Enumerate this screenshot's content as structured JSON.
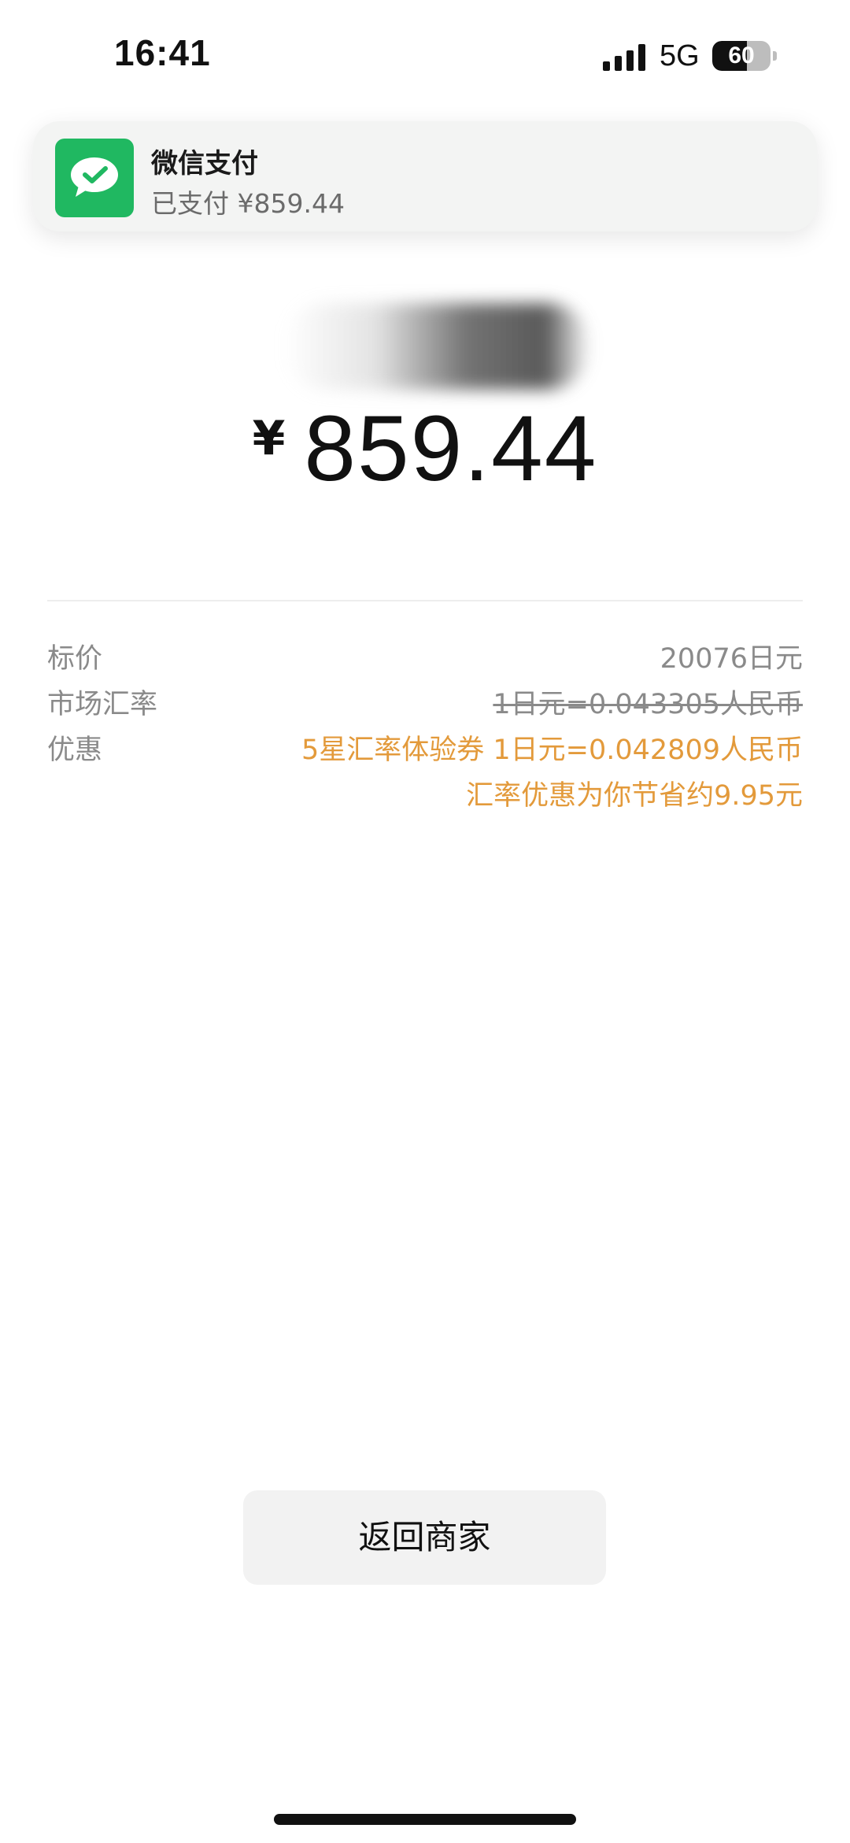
{
  "status_bar": {
    "time": "16:41",
    "network": "5G",
    "battery_level": "60",
    "battery_fraction": 0.6,
    "signal_icon": "signal-bars-icon"
  },
  "notification": {
    "app_icon": "wechat-pay-icon",
    "title": "微信支付",
    "body": "已支付 ¥859.44"
  },
  "payment": {
    "currency_symbol": "¥",
    "amount": "859.44"
  },
  "details": [
    {
      "label": "标价",
      "value": "20076日元",
      "style": "normal"
    },
    {
      "label": "市场汇率",
      "value": "1日元=0.043305人民币",
      "style": "strike"
    },
    {
      "label": "优惠",
      "value": "5星汇率体验券 1日元=0.042809人民币",
      "style": "accent"
    },
    {
      "label": "",
      "value": "汇率优惠为你节省约9.95元",
      "style": "accent"
    }
  ],
  "actions": {
    "return_label": "返回商家"
  },
  "colors": {
    "accent": "#e39a3b",
    "wechat_green": "#20b861",
    "muted_text": "#8a8a8a"
  }
}
